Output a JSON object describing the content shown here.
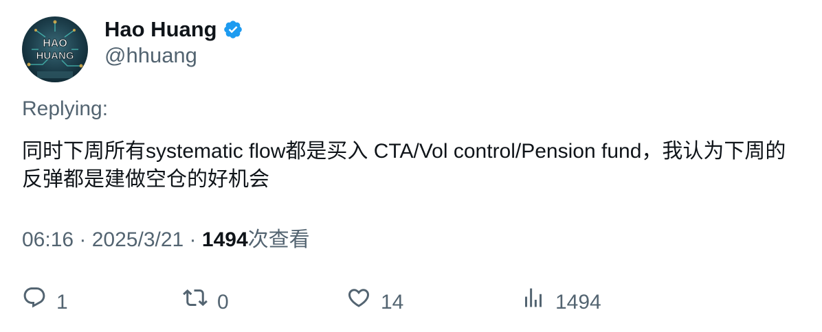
{
  "author": {
    "display_name": "Hao Huang",
    "handle": "@hhuang",
    "avatar_text_line1": "HAO",
    "avatar_text_line2": "HUANG",
    "verified_icon": "verified-badge-icon"
  },
  "replying_label": "Replying:",
  "tweet": {
    "text": "同时下周所有systematic flow都是买入 CTA/Vol control/Pension fund，我认为下周的反弹都是建做空仓的好机会"
  },
  "meta": {
    "time": "06:16",
    "separator": " · ",
    "date": "2025/3/21",
    "views_count": "1494",
    "views_label": "次查看"
  },
  "actions": {
    "reply": {
      "icon": "reply-icon",
      "count": "1"
    },
    "retweet": {
      "icon": "retweet-icon",
      "count": "0"
    },
    "like": {
      "icon": "heart-icon",
      "count": "14"
    },
    "views": {
      "icon": "bar-chart-icon",
      "count": "1494"
    }
  },
  "colors": {
    "text_primary": "#0f1419",
    "text_secondary": "#536471",
    "verified_blue": "#1d9bf0"
  }
}
